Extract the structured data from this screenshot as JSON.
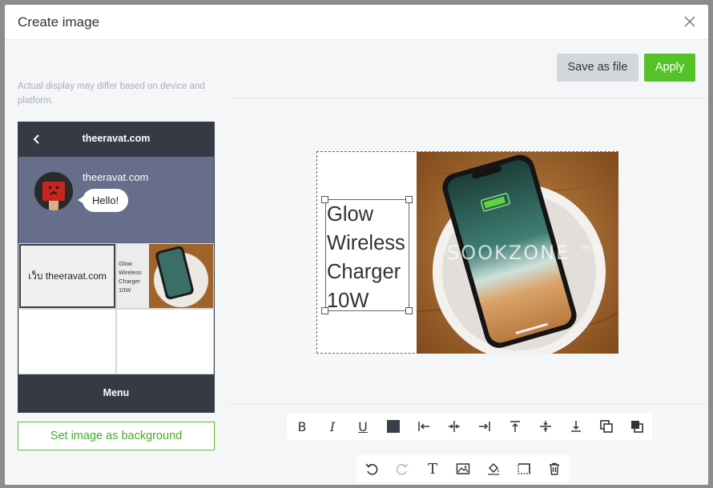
{
  "dialog": {
    "title": "Create image",
    "close_icon": "close-icon"
  },
  "preview": {
    "note": "Actual display may differ based on device and platform.",
    "chat_header_title": "theeravat.com",
    "sender_name": "theeravat.com",
    "message": "Hello!",
    "cell1_text": "เว็บ theeravat.com",
    "mini_text": "Glow Wireless Charger 10W",
    "menu_label": "Menu",
    "set_bg_label": "Set image as background"
  },
  "toolbar": {
    "save_label": "Save as file",
    "apply_label": "Apply"
  },
  "canvas": {
    "text_lines": [
      "Glow",
      "Wireless",
      "Charger",
      "10W"
    ],
    "watermark": "SOOKZONE",
    "watermark_small": "สุข ซน"
  },
  "tools_row1": [
    "bold-tool",
    "italic-tool",
    "underline-tool",
    "color-tool",
    "align-left-tool",
    "align-center-tool",
    "align-right-tool",
    "align-top-tool",
    "align-middle-tool",
    "align-bottom-tool",
    "bring-forward-tool",
    "send-backward-tool"
  ],
  "tools_row2": [
    "undo-tool",
    "redo-tool",
    "add-text-tool",
    "add-image-tool",
    "fill-color-tool",
    "crop-tool",
    "delete-tool"
  ],
  "tool_glyphs": {
    "bold": "B",
    "italic": "I",
    "underline": "U",
    "text": "T"
  },
  "colors": {
    "accent_green": "#56c22a",
    "phone_dark": "#353a45",
    "chat_bg": "#676e8c"
  }
}
